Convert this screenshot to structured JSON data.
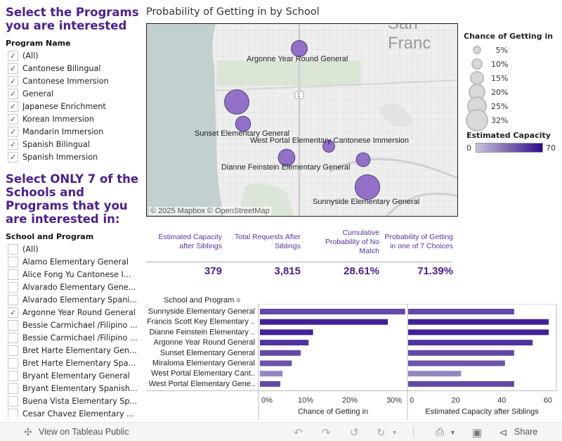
{
  "filters": {
    "program_title": "Select the Programs you are interested",
    "program_header": "Program Name",
    "programs": [
      {
        "label": "(All)",
        "checked": true
      },
      {
        "label": "Cantonese Bilingual",
        "checked": true
      },
      {
        "label": "Cantonese Immersion",
        "checked": true
      },
      {
        "label": "General",
        "checked": true
      },
      {
        "label": "Japanese Enrichment",
        "checked": true
      },
      {
        "label": "Korean Immersion",
        "checked": true
      },
      {
        "label": "Mandarin Immersion",
        "checked": true
      },
      {
        "label": "Spanish Bilingual",
        "checked": true
      },
      {
        "label": "Spanish Immersion",
        "checked": true
      }
    ],
    "school_title": "Select ONLY 7 of the Schools and Programs that you are interested in:",
    "school_header": "School and Program",
    "schools": [
      {
        "label": "(All)",
        "checked": false
      },
      {
        "label": "Alamo Elementary General",
        "checked": false
      },
      {
        "label": "Alice Fong Yu Cantonese I...",
        "checked": false
      },
      {
        "label": "Alvarado Elementary Gene...",
        "checked": false
      },
      {
        "label": "Alvarado Elementary Spani...",
        "checked": false
      },
      {
        "label": "Argonne Year Round General",
        "checked": true
      },
      {
        "label": "Bessie Carmichael /Filipino ...",
        "checked": false
      },
      {
        "label": "Bessie Carmichael /Filipino ...",
        "checked": false
      },
      {
        "label": "Bret Harte Elementary Gen...",
        "checked": false
      },
      {
        "label": "Bret Harte Elementary Spa...",
        "checked": false
      },
      {
        "label": "Bryant Elementary General",
        "checked": false
      },
      {
        "label": "Bryant Elementary Spanish...",
        "checked": false
      },
      {
        "label": "Buena Vista Elementary Sp...",
        "checked": false
      },
      {
        "label": "Cesar Chavez Elementary ...",
        "checked": false
      }
    ]
  },
  "map": {
    "title": "Probability of Getting in by School",
    "city_label": "San Franc",
    "route_label": "1",
    "attribution": "© 2025 Mapbox  © OpenStreetMap",
    "points": [
      {
        "label": "Argonne Year Round  General",
        "chance": 11,
        "capacity": 54
      },
      {
        "label": "",
        "chance": 32,
        "capacity": 46
      },
      {
        "label": "Sunset Elementary  General",
        "chance": 9.2,
        "capacity": 46
      },
      {
        "label": "West Portal Elementary  Cantonese Immersion",
        "chance": 4.6,
        "capacity": 46
      },
      {
        "label": "Dianne Feinstein Elementary  General",
        "chance": 12,
        "capacity": 61
      },
      {
        "label": "",
        "chance": 7.2,
        "capacity": 42
      },
      {
        "label": "Sunnyside Elementary  General",
        "chance": 32.8,
        "capacity": 46
      }
    ]
  },
  "legend": {
    "size_title": "Chance of Getting in",
    "sizes": [
      "5%",
      "10%",
      "15%",
      "20%",
      "25%",
      "32%"
    ],
    "color_title": "Estimated Capacity",
    "color_min": "0",
    "color_max": "70",
    "color_low": "#c9c3d9",
    "color_high": "#2e0a8c"
  },
  "kpis": [
    {
      "header": "Estimated Capacity after Siblings",
      "value": "379"
    },
    {
      "header": "Total Requests After Siblings",
      "value": "3,815"
    },
    {
      "header": "Cumulative Probability of No Match",
      "value": "28.61%"
    },
    {
      "header": "Probability of Getting in one of 7 Choices",
      "value": "71.39%"
    }
  ],
  "chart_data": {
    "type": "bar",
    "row_header": "School and Program",
    "categories": [
      "Sunnyside Elementary  General",
      "Francis Scott Key Elementary ..",
      "Dianne Feinstein Elementary  ..",
      "Argonne Year Round  General",
      "Sunset Elementary  General",
      "Miraloma Elementary  General",
      "West Portal Elementary  Cant..",
      "West Portal Elementary  Gene.."
    ],
    "series": [
      {
        "name": "Chance of Getting in",
        "unit": "%",
        "values": [
          32.8,
          28.9,
          12.0,
          11.0,
          9.2,
          7.2,
          5.1,
          4.6
        ],
        "xlim": [
          0,
          33
        ],
        "ticks": [
          "0%",
          "10%",
          "20%",
          "30%"
        ],
        "tick_values": [
          0,
          10,
          20,
          30
        ]
      },
      {
        "name": "Estimated Capacity  after Siblings",
        "unit": "",
        "values": [
          46,
          61,
          61,
          54,
          46,
          42,
          23,
          46
        ],
        "xlim": [
          0,
          64
        ],
        "ticks": [
          "0",
          "20",
          "40",
          "60"
        ],
        "tick_values": [
          0,
          20,
          40,
          60
        ]
      }
    ],
    "bar_color_by": "capacity"
  },
  "footer": {
    "view_label": "View on Tableau Public",
    "share_label": "Share"
  }
}
